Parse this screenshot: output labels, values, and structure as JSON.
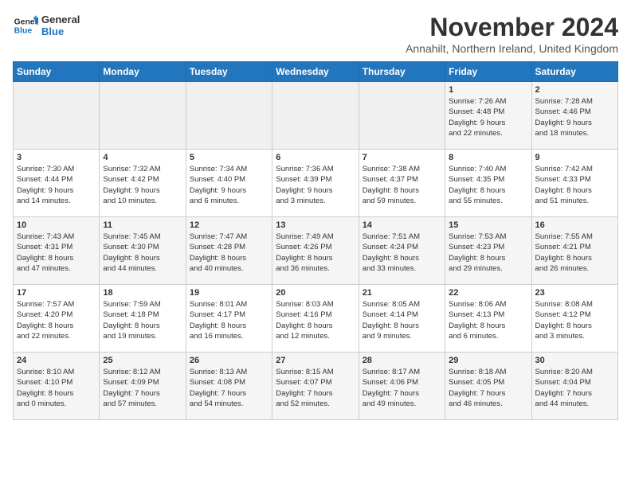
{
  "logo": {
    "line1": "General",
    "line2": "Blue"
  },
  "title": "November 2024",
  "subtitle": "Annahilt, Northern Ireland, United Kingdom",
  "days_of_week": [
    "Sunday",
    "Monday",
    "Tuesday",
    "Wednesday",
    "Thursday",
    "Friday",
    "Saturday"
  ],
  "weeks": [
    [
      {
        "day": "",
        "info": ""
      },
      {
        "day": "",
        "info": ""
      },
      {
        "day": "",
        "info": ""
      },
      {
        "day": "",
        "info": ""
      },
      {
        "day": "",
        "info": ""
      },
      {
        "day": "1",
        "info": "Sunrise: 7:26 AM\nSunset: 4:48 PM\nDaylight: 9 hours\nand 22 minutes."
      },
      {
        "day": "2",
        "info": "Sunrise: 7:28 AM\nSunset: 4:46 PM\nDaylight: 9 hours\nand 18 minutes."
      }
    ],
    [
      {
        "day": "3",
        "info": "Sunrise: 7:30 AM\nSunset: 4:44 PM\nDaylight: 9 hours\nand 14 minutes."
      },
      {
        "day": "4",
        "info": "Sunrise: 7:32 AM\nSunset: 4:42 PM\nDaylight: 9 hours\nand 10 minutes."
      },
      {
        "day": "5",
        "info": "Sunrise: 7:34 AM\nSunset: 4:40 PM\nDaylight: 9 hours\nand 6 minutes."
      },
      {
        "day": "6",
        "info": "Sunrise: 7:36 AM\nSunset: 4:39 PM\nDaylight: 9 hours\nand 3 minutes."
      },
      {
        "day": "7",
        "info": "Sunrise: 7:38 AM\nSunset: 4:37 PM\nDaylight: 8 hours\nand 59 minutes."
      },
      {
        "day": "8",
        "info": "Sunrise: 7:40 AM\nSunset: 4:35 PM\nDaylight: 8 hours\nand 55 minutes."
      },
      {
        "day": "9",
        "info": "Sunrise: 7:42 AM\nSunset: 4:33 PM\nDaylight: 8 hours\nand 51 minutes."
      }
    ],
    [
      {
        "day": "10",
        "info": "Sunrise: 7:43 AM\nSunset: 4:31 PM\nDaylight: 8 hours\nand 47 minutes."
      },
      {
        "day": "11",
        "info": "Sunrise: 7:45 AM\nSunset: 4:30 PM\nDaylight: 8 hours\nand 44 minutes."
      },
      {
        "day": "12",
        "info": "Sunrise: 7:47 AM\nSunset: 4:28 PM\nDaylight: 8 hours\nand 40 minutes."
      },
      {
        "day": "13",
        "info": "Sunrise: 7:49 AM\nSunset: 4:26 PM\nDaylight: 8 hours\nand 36 minutes."
      },
      {
        "day": "14",
        "info": "Sunrise: 7:51 AM\nSunset: 4:24 PM\nDaylight: 8 hours\nand 33 minutes."
      },
      {
        "day": "15",
        "info": "Sunrise: 7:53 AM\nSunset: 4:23 PM\nDaylight: 8 hours\nand 29 minutes."
      },
      {
        "day": "16",
        "info": "Sunrise: 7:55 AM\nSunset: 4:21 PM\nDaylight: 8 hours\nand 26 minutes."
      }
    ],
    [
      {
        "day": "17",
        "info": "Sunrise: 7:57 AM\nSunset: 4:20 PM\nDaylight: 8 hours\nand 22 minutes."
      },
      {
        "day": "18",
        "info": "Sunrise: 7:59 AM\nSunset: 4:18 PM\nDaylight: 8 hours\nand 19 minutes."
      },
      {
        "day": "19",
        "info": "Sunrise: 8:01 AM\nSunset: 4:17 PM\nDaylight: 8 hours\nand 16 minutes."
      },
      {
        "day": "20",
        "info": "Sunrise: 8:03 AM\nSunset: 4:16 PM\nDaylight: 8 hours\nand 12 minutes."
      },
      {
        "day": "21",
        "info": "Sunrise: 8:05 AM\nSunset: 4:14 PM\nDaylight: 8 hours\nand 9 minutes."
      },
      {
        "day": "22",
        "info": "Sunrise: 8:06 AM\nSunset: 4:13 PM\nDaylight: 8 hours\nand 6 minutes."
      },
      {
        "day": "23",
        "info": "Sunrise: 8:08 AM\nSunset: 4:12 PM\nDaylight: 8 hours\nand 3 minutes."
      }
    ],
    [
      {
        "day": "24",
        "info": "Sunrise: 8:10 AM\nSunset: 4:10 PM\nDaylight: 8 hours\nand 0 minutes."
      },
      {
        "day": "25",
        "info": "Sunrise: 8:12 AM\nSunset: 4:09 PM\nDaylight: 7 hours\nand 57 minutes."
      },
      {
        "day": "26",
        "info": "Sunrise: 8:13 AM\nSunset: 4:08 PM\nDaylight: 7 hours\nand 54 minutes."
      },
      {
        "day": "27",
        "info": "Sunrise: 8:15 AM\nSunset: 4:07 PM\nDaylight: 7 hours\nand 52 minutes."
      },
      {
        "day": "28",
        "info": "Sunrise: 8:17 AM\nSunset: 4:06 PM\nDaylight: 7 hours\nand 49 minutes."
      },
      {
        "day": "29",
        "info": "Sunrise: 8:18 AM\nSunset: 4:05 PM\nDaylight: 7 hours\nand 46 minutes."
      },
      {
        "day": "30",
        "info": "Sunrise: 8:20 AM\nSunset: 4:04 PM\nDaylight: 7 hours\nand 44 minutes."
      }
    ]
  ]
}
